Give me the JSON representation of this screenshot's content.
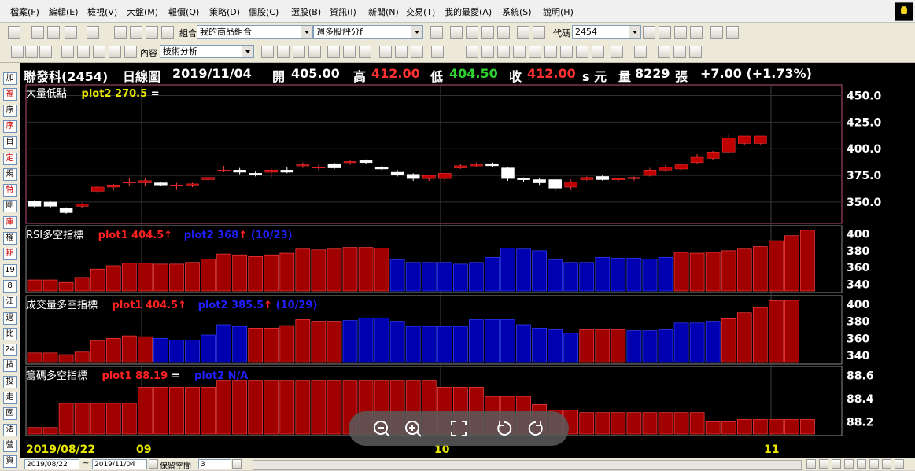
{
  "menu": [
    "檔案(F)",
    "編輯(E)",
    "檢視(V)",
    "大盤(M)",
    "報價(Q)",
    "策略(D)",
    "個股(C)",
    "選股(B)",
    "資訊(I)",
    "新聞(N)",
    "交易(T)",
    "我的最愛(A)",
    "系統(S)",
    "說明(H)"
  ],
  "toolbar1": {
    "portfolio_label": "組合",
    "portfolio_value": "我的商品組合",
    "indicator_value": "週多股評分f",
    "code_label": "代碼",
    "code_value": "2454"
  },
  "toolbar2": {
    "content_label": "內容",
    "content_value": "技術分析"
  },
  "left_strip": [
    "加",
    "福",
    "序",
    "序",
    "目",
    "定",
    "規",
    "特",
    "剛",
    "庫",
    "權",
    "期",
    "19",
    "8",
    "江",
    "過",
    "比",
    "24",
    "技",
    "投",
    "走",
    "國",
    "法",
    "營",
    "資"
  ],
  "header": {
    "name": "聯發科(2454)",
    "period": "日線圖",
    "date": "2019/11/04",
    "open_label": "開",
    "open": "405.00",
    "high_label": "高",
    "high": "412.00",
    "low_label": "低",
    "low": "404.50",
    "close_label": "收",
    "close": "412.00",
    "unit": "s 元",
    "vol_label": "量",
    "volume": "8229",
    "vol_unit": "張",
    "change": "+7.00 (+1.73%)"
  },
  "panels": {
    "price": {
      "name": "大量低點",
      "plot2": "plot2 270.5",
      "eq": "="
    },
    "rsi": {
      "name": "RSI多空指標",
      "plot1": "plot1 404.5",
      "plot2": "plot2 368",
      "date": "(10/23)"
    },
    "volume": {
      "name": "成交量多空指標",
      "plot1": "plot1 404.5",
      "plot2": "plot2 385.5",
      "date": "(10/29)"
    },
    "chips": {
      "name": "籌碼多空指標",
      "plot1": "plot1 88.19",
      "eq": "=",
      "plot2": "plot2 N/A"
    }
  },
  "x_labels": {
    "start": "2019/08/22",
    "m9": "09",
    "m10": "10",
    "m11": "11"
  },
  "bottom": {
    "from": "2019/08/22",
    "tilde": "~",
    "to": "2019/11/04",
    "keep_label": "保留空間",
    "keep_value": "3"
  },
  "colors": {
    "up": "#c00000",
    "down": "#ffffff",
    "rsi_blue": "#0000b0",
    "bg": "#000000"
  },
  "chart_data": [
    {
      "type": "candlestick",
      "title": "大量低點",
      "ylim": [
        330,
        460
      ],
      "yticks": [
        "450.0",
        "425.0",
        "400.0",
        "375.0",
        "350.0"
      ],
      "ohlc": [
        [
          351,
          352,
          344,
          346
        ],
        [
          350,
          351,
          344,
          346
        ],
        [
          344,
          345,
          339,
          340
        ],
        [
          346,
          349,
          344,
          348
        ],
        [
          360,
          366,
          358,
          364
        ],
        [
          364,
          367,
          362,
          366
        ],
        [
          368,
          372,
          365,
          369
        ],
        [
          368,
          372,
          365,
          370
        ],
        [
          368,
          369,
          365,
          366
        ],
        [
          366,
          368,
          362,
          366
        ],
        [
          366,
          368,
          364,
          367
        ],
        [
          371,
          375,
          367,
          373
        ],
        [
          380,
          384,
          378,
          380
        ],
        [
          380,
          382,
          376,
          378
        ],
        [
          377,
          379,
          374,
          376
        ],
        [
          378,
          382,
          373,
          380
        ],
        [
          380,
          383,
          377,
          378
        ],
        [
          384,
          387,
          382,
          385
        ],
        [
          383,
          385,
          380,
          383
        ],
        [
          386,
          387,
          381,
          382
        ],
        [
          387,
          389,
          385,
          388
        ],
        [
          389,
          390,
          386,
          387
        ],
        [
          383,
          384,
          380,
          381
        ],
        [
          378,
          380,
          374,
          376
        ],
        [
          376,
          377,
          370,
          372
        ],
        [
          372,
          376,
          370,
          375
        ],
        [
          372,
          378,
          369,
          377
        ],
        [
          382,
          386,
          381,
          384
        ],
        [
          384,
          387,
          383,
          385
        ],
        [
          386,
          387,
          383,
          384
        ],
        [
          382,
          383,
          370,
          372
        ],
        [
          372,
          373,
          369,
          371
        ],
        [
          371,
          372,
          366,
          368
        ],
        [
          371,
          372,
          360,
          363
        ],
        [
          364,
          371,
          362,
          369
        ],
        [
          371,
          374,
          370,
          373
        ],
        [
          374,
          375,
          370,
          371
        ],
        [
          371,
          373,
          369,
          372
        ],
        [
          372,
          374,
          370,
          373
        ],
        [
          375,
          382,
          374,
          380
        ],
        [
          380,
          385,
          378,
          383
        ],
        [
          381,
          386,
          380,
          385
        ],
        [
          387,
          395,
          386,
          392
        ],
        [
          391,
          398,
          389,
          397
        ],
        [
          397,
          413,
          396,
          410
        ],
        [
          405,
          412,
          404,
          412
        ],
        [
          405,
          412,
          404,
          412
        ]
      ]
    },
    {
      "type": "bar",
      "title": "RSI多空指標",
      "ylim": [
        330,
        410
      ],
      "yticks": [
        "400",
        "380",
        "360",
        "340"
      ],
      "values": [
        345,
        345,
        342,
        348,
        358,
        362,
        365,
        365,
        364,
        364,
        366,
        370,
        376,
        375,
        373,
        375,
        377,
        382,
        381,
        382,
        384,
        384,
        383,
        369,
        366,
        366,
        366,
        364,
        366,
        372,
        383,
        382,
        380,
        369,
        366,
        366,
        372,
        371,
        371,
        370,
        372,
        378,
        377,
        378,
        380,
        382,
        385,
        392,
        398,
        404.5
      ],
      "colors": [
        "r",
        "r",
        "r",
        "r",
        "r",
        "r",
        "r",
        "r",
        "r",
        "r",
        "r",
        "r",
        "r",
        "r",
        "r",
        "r",
        "r",
        "r",
        "r",
        "r",
        "r",
        "r",
        "r",
        "b",
        "b",
        "b",
        "b",
        "b",
        "b",
        "b",
        "b",
        "b",
        "b",
        "b",
        "b",
        "b",
        "b",
        "b",
        "b",
        "b",
        "b",
        "r",
        "r",
        "r",
        "r",
        "r",
        "r",
        "r",
        "r",
        "r"
      ]
    },
    {
      "type": "bar",
      "title": "成交量多空指標",
      "ylim": [
        330,
        410
      ],
      "yticks": [
        "400",
        "380",
        "360",
        "340"
      ],
      "values": [
        343,
        343,
        341,
        344,
        357,
        360,
        363,
        362,
        360,
        358,
        358,
        364,
        376,
        374,
        372,
        372,
        375,
        382,
        380,
        380,
        381,
        384,
        384,
        380,
        374,
        374,
        374,
        374,
        382,
        382,
        382,
        376,
        372,
        370,
        366,
        370,
        370,
        370,
        369,
        369,
        370,
        378,
        378,
        380,
        383,
        390,
        396,
        404,
        404.5
      ],
      "colors": [
        "r",
        "r",
        "r",
        "r",
        "r",
        "r",
        "r",
        "r",
        "b",
        "b",
        "b",
        "b",
        "b",
        "b",
        "r",
        "r",
        "r",
        "r",
        "r",
        "r",
        "b",
        "b",
        "b",
        "b",
        "b",
        "b",
        "b",
        "b",
        "b",
        "b",
        "b",
        "b",
        "b",
        "b",
        "b",
        "r",
        "r",
        "r",
        "b",
        "b",
        "b",
        "b",
        "b",
        "b",
        "r",
        "r",
        "r",
        "r",
        "r"
      ]
    },
    {
      "type": "bar",
      "title": "籌碼多空指標",
      "ylim": [
        88.08,
        88.68
      ],
      "yticks": [
        "88.6",
        "88.4",
        "88.2"
      ],
      "values": [
        88.15,
        88.15,
        88.36,
        88.36,
        88.36,
        88.36,
        88.36,
        88.5,
        88.5,
        88.5,
        88.5,
        88.5,
        88.56,
        88.56,
        88.56,
        88.56,
        88.56,
        88.56,
        88.56,
        88.56,
        88.56,
        88.56,
        88.56,
        88.56,
        88.56,
        88.56,
        88.5,
        88.5,
        88.5,
        88.42,
        88.42,
        88.42,
        88.35,
        88.3,
        88.3,
        88.28,
        88.28,
        88.28,
        88.28,
        88.28,
        88.28,
        88.28,
        88.28,
        88.2,
        88.2,
        88.22,
        88.22,
        88.22,
        88.22,
        88.22
      ],
      "colors": [
        "r"
      ]
    }
  ]
}
